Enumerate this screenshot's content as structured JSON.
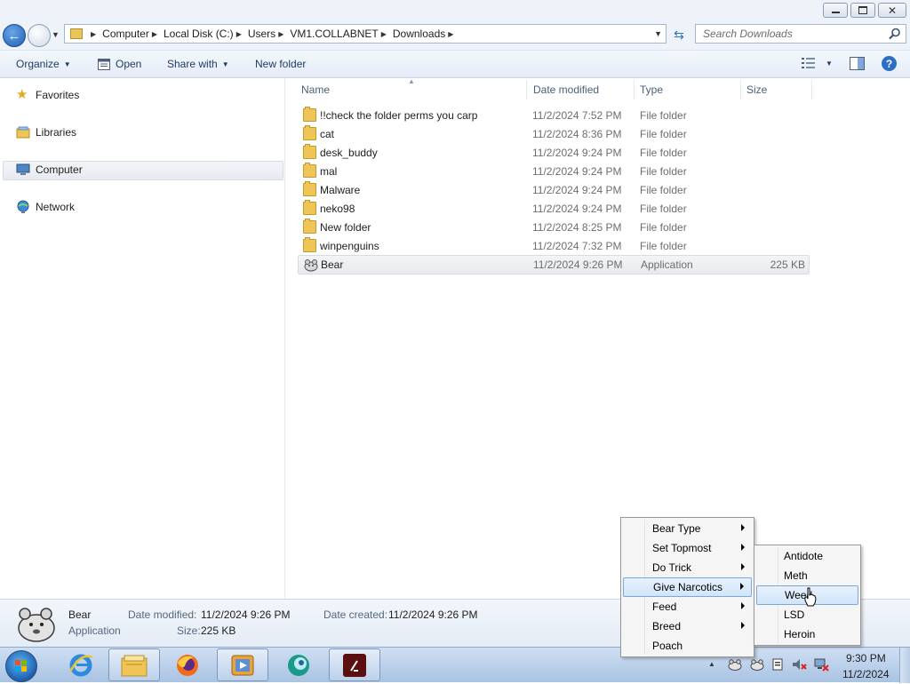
{
  "window": {
    "breadcrumbs": [
      "Computer",
      "Local Disk (C:)",
      "Users",
      "VM1.COLLABNET",
      "Downloads"
    ],
    "search_placeholder": "Search Downloads"
  },
  "commandbar": {
    "organize": "Organize",
    "open": "Open",
    "share_with": "Share with",
    "new_folder": "New folder"
  },
  "nav": {
    "favorites": "Favorites",
    "libraries": "Libraries",
    "computer": "Computer",
    "network": "Network"
  },
  "columns": {
    "name": "Name",
    "date": "Date modified",
    "type": "Type",
    "size": "Size"
  },
  "files": [
    {
      "name": "!!check the folder perms you carp",
      "date": "11/2/2024 7:52 PM",
      "type": "File folder",
      "size": "",
      "icon": "folder-icon"
    },
    {
      "name": "cat",
      "date": "11/2/2024 8:36 PM",
      "type": "File folder",
      "size": "",
      "icon": "folder-icon"
    },
    {
      "name": "desk_buddy",
      "date": "11/2/2024 9:24 PM",
      "type": "File folder",
      "size": "",
      "icon": "folder-icon"
    },
    {
      "name": "mal",
      "date": "11/2/2024 9:24 PM",
      "type": "File folder",
      "size": "",
      "icon": "folder-icon"
    },
    {
      "name": "Malware",
      "date": "11/2/2024 9:24 PM",
      "type": "File folder",
      "size": "",
      "icon": "folder-icon"
    },
    {
      "name": "neko98",
      "date": "11/2/2024 9:24 PM",
      "type": "File folder",
      "size": "",
      "icon": "folder-icon"
    },
    {
      "name": "New folder",
      "date": "11/2/2024 8:25 PM",
      "type": "File folder",
      "size": "",
      "icon": "folder-icon"
    },
    {
      "name": "winpenguins",
      "date": "11/2/2024 7:32 PM",
      "type": "File folder",
      "size": "",
      "icon": "folder-icon"
    },
    {
      "name": "Bear",
      "date": "11/2/2024 9:26 PM",
      "type": "Application",
      "size": "225 KB",
      "icon": "bear-app-icon"
    }
  ],
  "details": {
    "name": "Bear",
    "kind": "Application",
    "date_modified_label": "Date modified:",
    "date_modified": "11/2/2024 9:26 PM",
    "date_created_label": "Date created:",
    "date_created": "11/2/2024 9:26 PM",
    "size_label": "Size:",
    "size": "225 KB"
  },
  "context_menu": {
    "items": [
      "Bear Type",
      "Set Topmost",
      "Do Trick",
      "Give Narcotics",
      "Feed",
      "Breed",
      "Poach"
    ],
    "submenu": [
      "Antidote",
      "Meth",
      "Weed",
      "LSD",
      "Heroin"
    ],
    "active_item": "Give Narcotics",
    "active_subitem": "Weed"
  },
  "taskbar": {
    "time": "9:30 PM",
    "date": "11/2/2024",
    "apps": [
      "internet-explorer-icon",
      "file-explorer-icon",
      "firefox-icon",
      "media-player-icon",
      "chat-app-icon",
      "terminal-app-icon"
    ]
  },
  "colors": {
    "accent": "#1f5fb5",
    "selection_bg": "#d1e5fa",
    "folder": "#eec556",
    "taskbar": "#a9c3e3"
  }
}
